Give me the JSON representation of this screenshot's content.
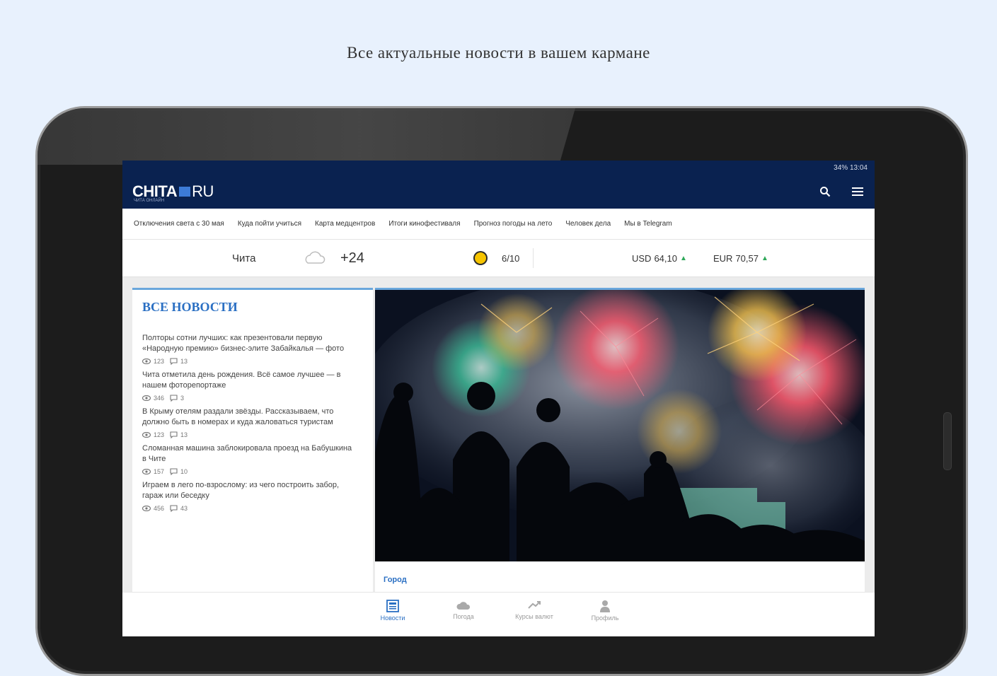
{
  "tagline": "Все актуальные новости в вашем кармане",
  "status": {
    "text": "34% 13:04"
  },
  "brand": {
    "name": "CHITA",
    "tld": "RU",
    "subtitle": "ЧИТА ОНЛАЙН"
  },
  "quicklinks": [
    "Отключения света с 30 мая",
    "Куда пойти учиться",
    "Карта медцентров",
    "Итоги кинофестиваля",
    "Прогноз погоды на лето",
    "Человек дела",
    "Мы в Telegram"
  ],
  "info": {
    "city": "Чита",
    "temp": "+24",
    "score": "6/10",
    "usd_label": "USD",
    "usd_value": "64,10",
    "eur_label": "EUR",
    "eur_value": "70,57",
    "trend_up_color": "#2fa85a"
  },
  "feed": {
    "title": "ВСЕ НОВОСТИ",
    "items": [
      {
        "title": "Полторы сотни лучших: как презентовали первую «Народную премию» бизнес-элите Забайкалья — фото",
        "views": "123",
        "comments": "13"
      },
      {
        "title": "Чита отметила день рождения. Всё самое лучшее — в нашем фоторепортаже",
        "views": "346",
        "comments": "3"
      },
      {
        "title": "В Крыму отелям раздали звёзды. Рассказываем, что должно быть в номерах и куда жаловаться туристам",
        "views": "123",
        "comments": "13"
      },
      {
        "title": "Сломанная машина заблокировала проезд на Бабушкина в Чите",
        "views": "157",
        "comments": "10"
      },
      {
        "title": "Играем в лего по-взрослому: из чего построить забор, гараж или беседку",
        "views": "456",
        "comments": "43"
      }
    ]
  },
  "hero": {
    "category": "Город"
  },
  "nav": [
    {
      "label": "Новости",
      "icon": "newspaper-icon",
      "active": true
    },
    {
      "label": "Погода",
      "icon": "cloud-icon",
      "active": false
    },
    {
      "label": "Курсы валют",
      "icon": "currency-icon",
      "active": false
    },
    {
      "label": "Профиль",
      "icon": "person-icon",
      "active": false
    }
  ],
  "colors": {
    "appbar": "#0a2250",
    "accent": "#2a6fc3",
    "page_bg": "#e8f1fd"
  }
}
